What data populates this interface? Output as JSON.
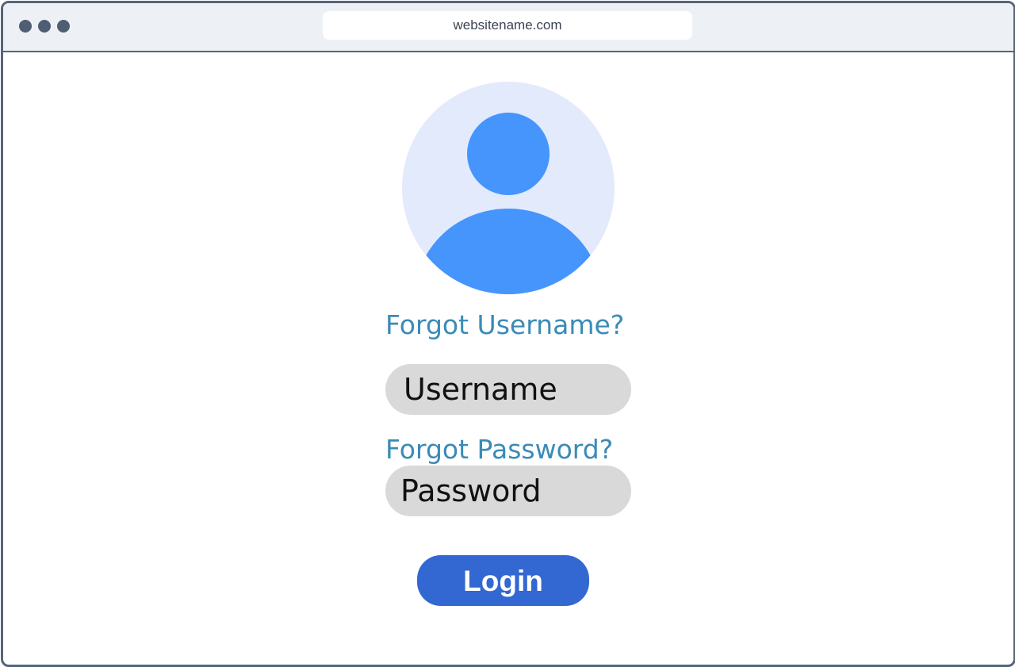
{
  "browser": {
    "url": "websitename.com",
    "window_controls": [
      "dot",
      "dot",
      "dot"
    ]
  },
  "avatar": {
    "icon": "user-avatar-icon",
    "background_color": "#e3eafc",
    "figure_color": "#4595fd"
  },
  "form": {
    "forgot_username_label": "Forgot Username?",
    "username_placeholder": "Username",
    "forgot_password_label": "Forgot Password?",
    "password_placeholder": "Password",
    "login_label": "Login"
  },
  "colors": {
    "link": "#3a8bb7",
    "field_background": "#d9d9d9",
    "button": "#3367d1",
    "frame": "#56657a"
  }
}
